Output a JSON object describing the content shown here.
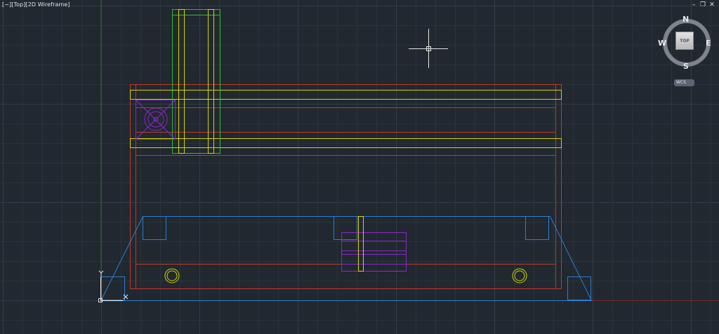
{
  "viewport": {
    "controls_label": "[−]",
    "view_label": "[Top]",
    "style_label": "[2D Wireframe]"
  },
  "window_controls": {
    "minimize": "–",
    "restore": "❐",
    "close": "✕"
  },
  "viewcube": {
    "north": "N",
    "south": "S",
    "east": "E",
    "west": "W",
    "face": "TOP"
  },
  "wcs_menu": {
    "label": "WCS"
  },
  "colors": {
    "background": "#212830",
    "grid_minor": "#2a323b",
    "grid_major": "#333c46",
    "red": "#c0392b",
    "yellow": "#d4d400",
    "green": "#2fb82f",
    "blue": "#2b7fd0",
    "magenta": "#8a28c8",
    "ucs": "#e8e8e8"
  }
}
